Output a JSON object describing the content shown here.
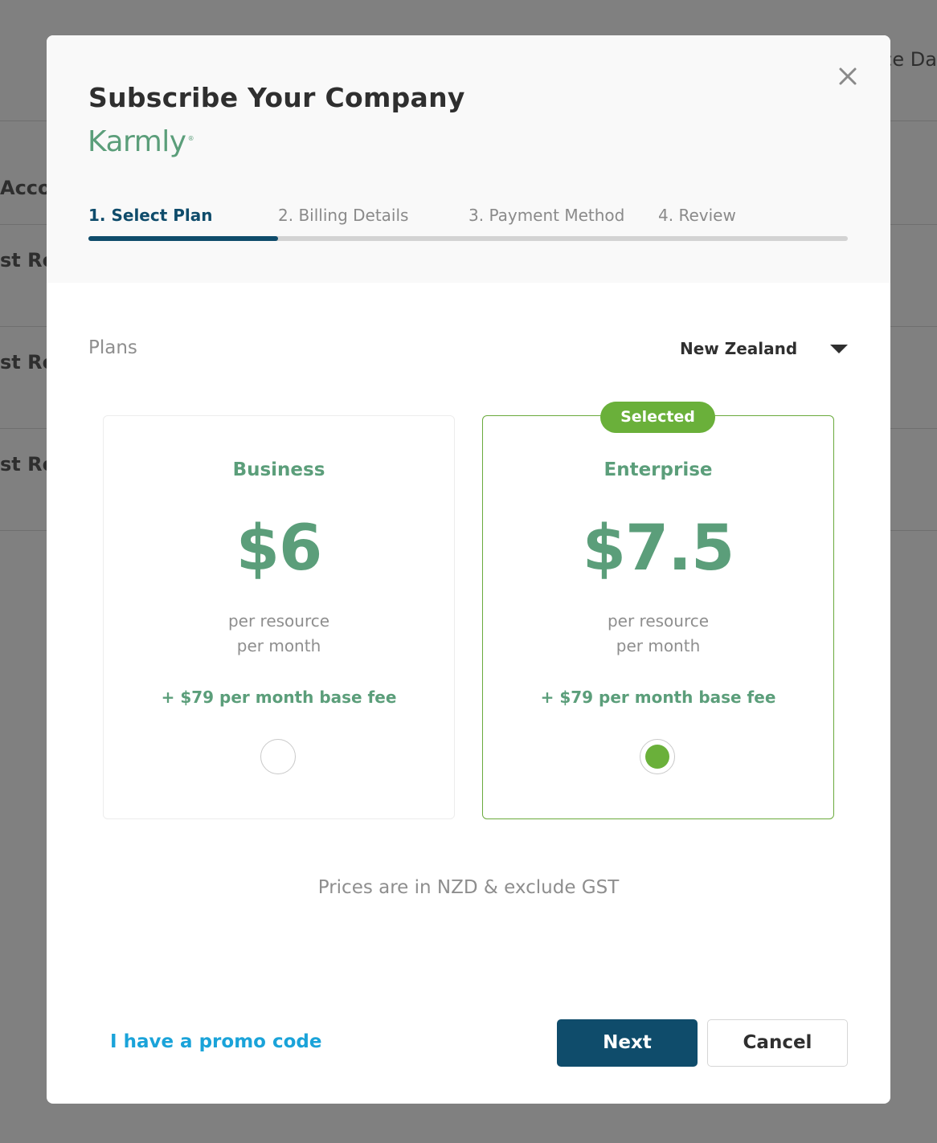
{
  "background": {
    "row_labels": [
      "Acco",
      "st Re",
      "st Re",
      "st Re"
    ],
    "header_right": "ce Da"
  },
  "modal": {
    "title": "Subscribe Your Company",
    "logo_text": "Karmly",
    "close_icon": "close-icon"
  },
  "steps": [
    {
      "label": "1. Select Plan",
      "active": true
    },
    {
      "label": "2. Billing Details",
      "active": false
    },
    {
      "label": "3. Payment Method",
      "active": false
    },
    {
      "label": "4. Review",
      "active": false
    }
  ],
  "progress": {
    "completed_fraction": 0.25
  },
  "plans_section": {
    "label": "Plans",
    "region": "New Zealand",
    "region_icon": "caret-down-icon"
  },
  "plans": [
    {
      "name": "Business",
      "price": "$6",
      "unit_line1": "per resource",
      "unit_line2": "per month",
      "fee": "+ $79 per month base fee",
      "selected": false
    },
    {
      "name": "Enterprise",
      "price": "$7.5",
      "unit_line1": "per resource",
      "unit_line2": "per month",
      "fee": "+ $79 per month base fee",
      "selected": true,
      "badge": "Selected"
    }
  ],
  "note": "Prices are in NZD & exclude GST",
  "footer": {
    "promo_link": "I have a promo code",
    "next_label": "Next",
    "cancel_label": "Cancel"
  },
  "colors": {
    "primary": "#0f4c6b",
    "brand_green": "#5b9e7a",
    "selected_green": "#6ab03a",
    "link_blue": "#1aa3d9"
  }
}
